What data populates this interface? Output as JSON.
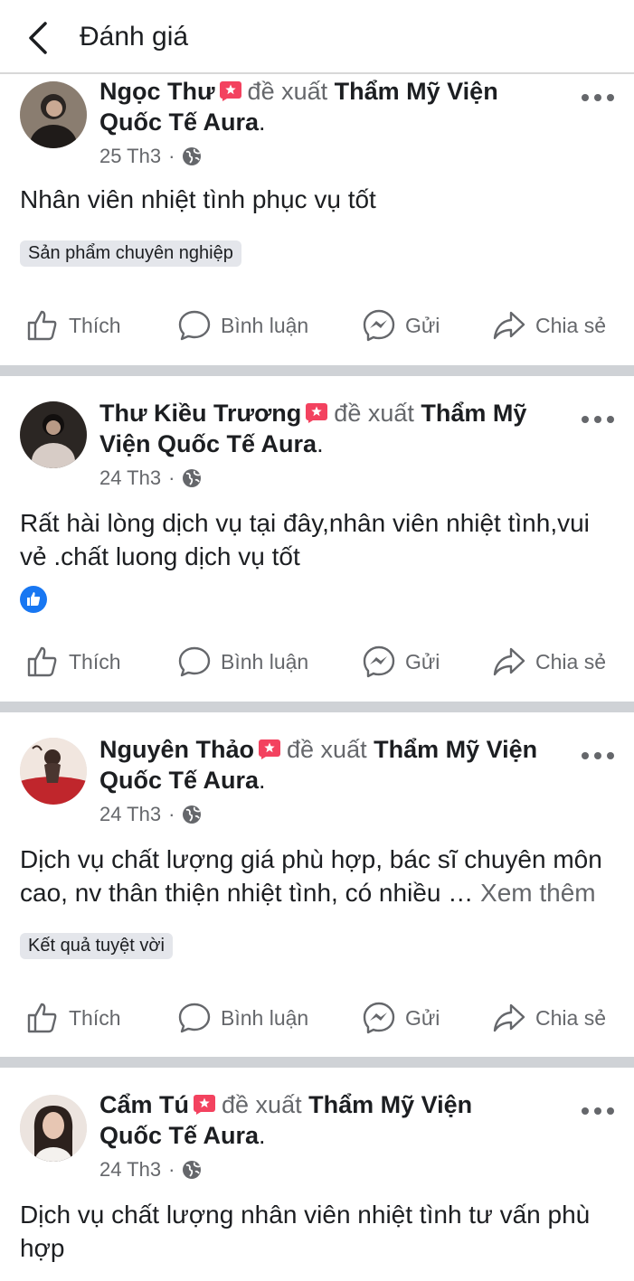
{
  "header": {
    "title": "Đánh giá"
  },
  "verb": "đề xuất",
  "actions": {
    "like": "Thích",
    "comment": "Bình luận",
    "send": "Gửi",
    "share": "Chia sẻ"
  },
  "posts": [
    {
      "author": "Ngọc Thư",
      "page_part1": "Thẩm Mỹ Viện",
      "page_part2": "Quốc Tế Aura",
      "date": "25 Th3",
      "text": "Nhân viên nhiệt tình phục vụ tốt",
      "tag": "Sản phẩm chuyên nghiệp"
    },
    {
      "author": "Thư Kiều Trương",
      "page_part1": "Thẩm Mỹ",
      "page_part2": "Viện Quốc Tế Aura",
      "date": "24 Th3",
      "text_line1": "Rất hài lòng dịch vụ tại đây,nhân viên nhiệt tình,vui",
      "text_line2": "vẻ .chất luong dịch vụ tốt"
    },
    {
      "author": "Nguyên Thảo",
      "page_part1": "Thẩm Mỹ Viện",
      "page_part2": "Quốc Tế Aura",
      "date": "24 Th3",
      "text_line1": "Dịch vụ chất lượng giá phù hợp, bác sĩ chuyên môn",
      "text_line2": "cao, nv thân thiện nhiệt tình, có nhiều … ",
      "see_more": "Xem thêm",
      "tag": "Kết quả tuyệt vời"
    },
    {
      "author": "Cẩm Tú",
      "page_part1": "Thẩm Mỹ Viện",
      "page_part2": "Quốc Tế Aura",
      "date": "24 Th3",
      "text_line1": "Dịch vụ chất lượng nhân viên nhiệt tình tư vấn phù",
      "text_line2": "hợp"
    }
  ],
  "colors": {
    "recommend_icon": "#f3425f",
    "like_blue": "#1877f2",
    "secondary_text": "#65676b",
    "separator": "#cfd2d6"
  },
  "icons": {
    "back": "chevron-left-icon",
    "recommend": "recommend-flag-icon",
    "privacy": "globe-icon",
    "more": "more-dots-icon",
    "like": "thumbs-up-icon",
    "comment": "comment-bubble-icon",
    "send": "messenger-icon",
    "share": "share-arrow-icon"
  }
}
